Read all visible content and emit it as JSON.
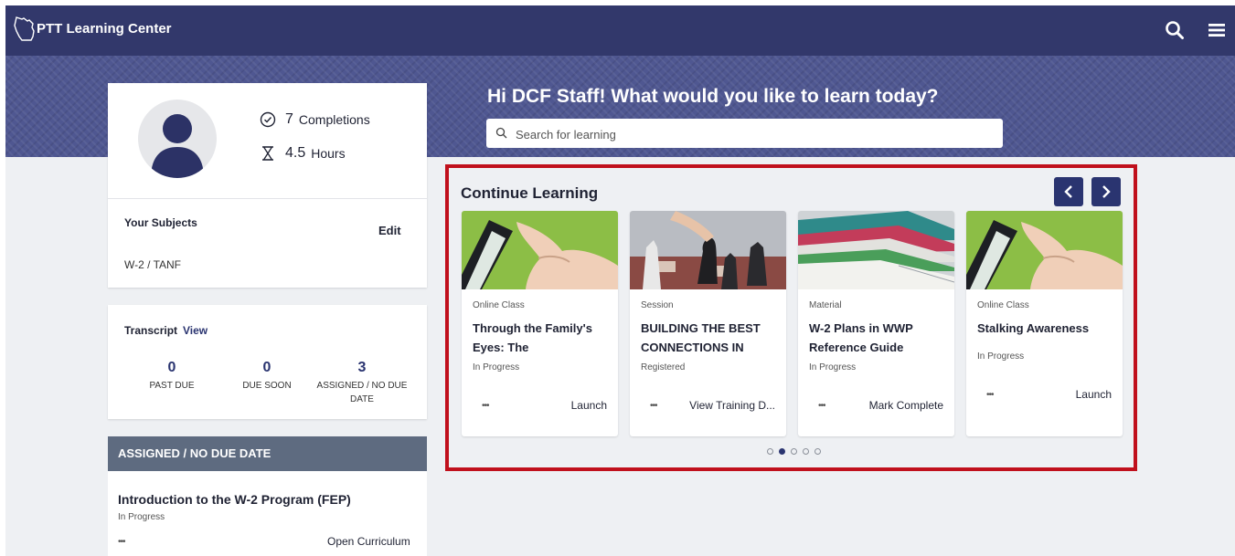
{
  "app": {
    "title": "PTT Learning Center"
  },
  "hero": {
    "greeting": "Hi DCF Staff! What would you like to learn today?",
    "search_placeholder": "Search for learning"
  },
  "profile": {
    "completions": {
      "value": "7",
      "label": "Completions"
    },
    "hours": {
      "value": "4.5",
      "label": "Hours"
    },
    "subjects_heading": "Your Subjects",
    "edit_label": "Edit",
    "subject": "W-2 / TANF"
  },
  "transcript": {
    "heading": "Transcript",
    "view_label": "View",
    "stats": [
      {
        "value": "0",
        "label": "PAST DUE"
      },
      {
        "value": "0",
        "label": "DUE SOON"
      },
      {
        "value": "3",
        "label": "ASSIGNED / NO DUE DATE"
      }
    ]
  },
  "assigned": {
    "heading": "ASSIGNED / NO DUE DATE",
    "item": {
      "title": "Introduction to the W-2 Program (FEP)",
      "status": "In Progress",
      "more": "•••",
      "action": "Open Curriculum"
    }
  },
  "continue_learning": {
    "title": "Continue Learning",
    "cards": [
      {
        "type": "Online Class",
        "title": "Through the Family's Eyes: The",
        "status": "In Progress",
        "more": "•••",
        "action": "Launch"
      },
      {
        "type": "Session",
        "title": "BUILDING THE BEST CONNECTIONS IN",
        "status": "Registered",
        "more": "•••",
        "action": "View Training D..."
      },
      {
        "type": "Material",
        "title": "W-2 Plans in WWP Reference Guide",
        "status": "In Progress",
        "more": "•••",
        "action": "Mark Complete"
      },
      {
        "type": "Online Class",
        "title": "Stalking Awareness",
        "status": "In Progress",
        "more": "•••",
        "action": "Launch"
      }
    ],
    "pager": {
      "count": 5,
      "active_index": 1
    }
  },
  "colors": {
    "topbar": "#32386b",
    "accent": "#2a3470",
    "highlight_outline": "#c0101c",
    "assigned_header": "#5e6b80"
  }
}
